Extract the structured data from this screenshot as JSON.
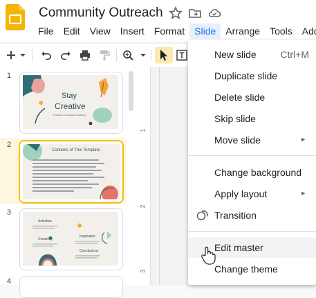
{
  "doc": {
    "title": "Community Outreach"
  },
  "menubar": [
    "File",
    "Edit",
    "View",
    "Insert",
    "Format",
    "Slide",
    "Arrange",
    "Tools",
    "Add"
  ],
  "filmstrip": {
    "slide_numbers": [
      "1",
      "2",
      "3",
      "4"
    ],
    "slide1": {
      "line1": "Stay",
      "line2": "Creative",
      "sub": "Practice innovative actions"
    },
    "slide2": {
      "heading": "Contents of This Template"
    },
    "slide3": {
      "activities": "Activities",
      "inspiration": "Inspiration",
      "creativity": "Creativity",
      "conclusions": "Conclusions"
    }
  },
  "ruler": [
    "1",
    "2",
    "3"
  ],
  "dropdown": {
    "items": [
      {
        "label": "New slide",
        "shortcut": "Ctrl+M"
      },
      {
        "label": "Duplicate slide"
      },
      {
        "label": "Delete slide"
      },
      {
        "label": "Skip slide"
      },
      {
        "label": "Move slide",
        "arrow": "►"
      },
      {
        "label": "Change background"
      },
      {
        "label": "Apply layout",
        "arrow": "►"
      },
      {
        "label": "Transition"
      },
      {
        "label": "Edit master"
      },
      {
        "label": "Change theme"
      }
    ]
  },
  "colors": {
    "accent_yellow": "#fbbc04",
    "accent_blue": "#1a73e8"
  }
}
